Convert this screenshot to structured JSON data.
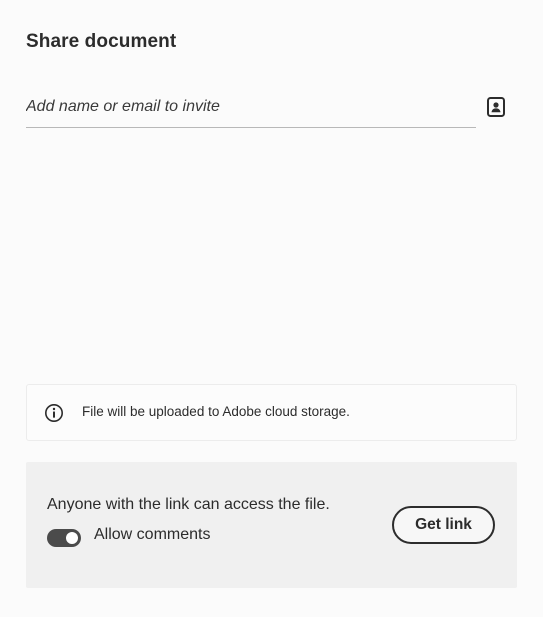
{
  "dialog": {
    "title": "Share document"
  },
  "invite": {
    "placeholder": "Add name or email to invite",
    "contacts_icon": "address-book-icon"
  },
  "info": {
    "icon": "info-icon",
    "text": "File will be uploaded to Adobe cloud storage."
  },
  "link_section": {
    "description": "Anyone with the link can access the file.",
    "allow_comments_label": "Allow comments",
    "allow_comments_on": true,
    "get_link_label": "Get link"
  },
  "colors": {
    "toggle_on": "#4b4b4b",
    "link_section_bg": "#f0f0f0",
    "text": "#2c2c2c"
  }
}
